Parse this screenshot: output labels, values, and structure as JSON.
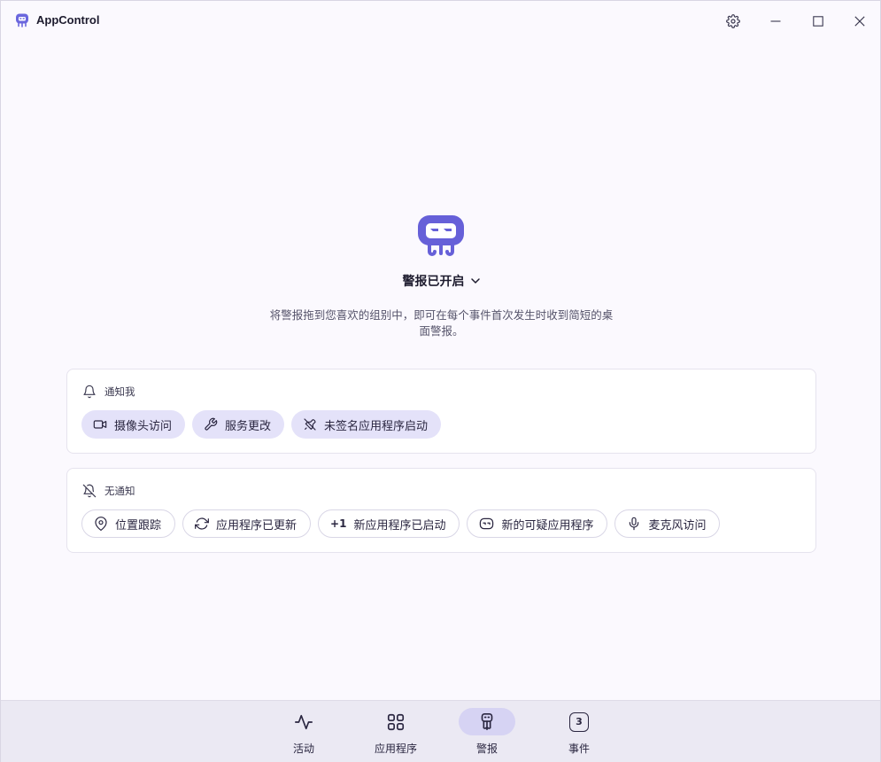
{
  "window": {
    "title": "AppControl",
    "accent_color": "#5b5bd6"
  },
  "titlebar": {
    "settings_icon": "gear-icon",
    "minimize_icon": "minimize-icon",
    "maximize_icon": "maximize-icon",
    "close_icon": "close-icon"
  },
  "hero": {
    "status": "警报已开启",
    "description": "将警报拖到您喜欢的组别中，即可在每个事件首次发生时收到简短的桌面警报。"
  },
  "notify_group": {
    "label": "通知我",
    "icon": "bell-icon",
    "chips": [
      {
        "label": "摄像头访问",
        "icon": "video-camera-icon"
      },
      {
        "label": "服务更改",
        "icon": "wrench-icon"
      },
      {
        "label": "未签名应用程序启动",
        "icon": "rocket-off-icon"
      }
    ]
  },
  "silent_group": {
    "label": "无通知",
    "icon": "bell-off-icon",
    "chips": [
      {
        "label": "位置跟踪",
        "icon": "map-pin-icon"
      },
      {
        "label": "应用程序已更新",
        "icon": "refresh-icon"
      },
      {
        "label": "新应用程序已启动",
        "icon": "plus-one-icon",
        "prefix": "+1"
      },
      {
        "label": "新的可疑应用程序",
        "icon": "suspicious-face-icon"
      },
      {
        "label": "麦克风访问",
        "icon": "microphone-icon"
      }
    ]
  },
  "bottom_nav": {
    "items": [
      {
        "label": "活动",
        "icon": "activity-icon"
      },
      {
        "label": "应用程序",
        "icon": "grid-icon"
      },
      {
        "label": "警报",
        "icon": "alert-bot-icon",
        "active": true
      },
      {
        "label": "事件",
        "icon": "events-badge-icon",
        "badge": "3"
      }
    ]
  }
}
